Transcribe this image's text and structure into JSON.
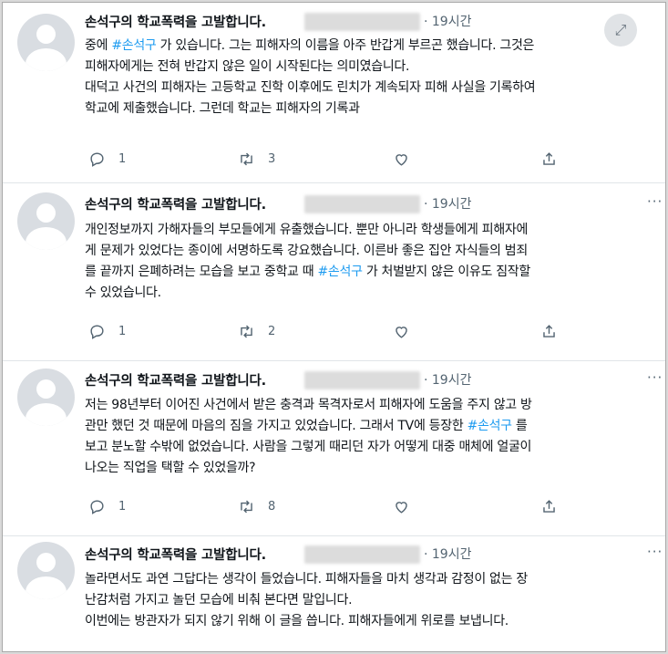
{
  "tweets": [
    {
      "name": "손석구의 학교폭력을 고발합니다.",
      "time": "· 19시간",
      "more": "···",
      "lines": [
        [
          "중에 ",
          "#손석구",
          " 가 있습니다. 그는 피해자의 이름을 아주 반갑게 부르곤 했습니다. 그것은"
        ],
        [
          "피해자에게는 전혀 반갑지 않은 일이 시작된다는 의미였습니다."
        ],
        [
          "대덕고 사건의 피해자는 고등학교 진학 이후에도 린치가 계속되자 피해 사실을 기록하여"
        ],
        [
          "학교에 제출했습니다. 그런데 학교는 피해자의 기록과"
        ]
      ],
      "replies": "1",
      "retweets": "3"
    },
    {
      "name": "손석구의 학교폭력을 고발합니다.",
      "time": "· 19시간",
      "more": "···",
      "lines": [
        [
          "개인정보까지 가해자들의 부모들에게 유출했습니다. 뿐만 아니라 학생들에게 피해자에"
        ],
        [
          "게 문제가 있었다는 종이에 서명하도록 강요했습니다. 이른바 좋은 집안 자식들의 범죄"
        ],
        [
          "를 끝까지 은폐하려는 모습을 보고 중학교 때 ",
          "#손석구",
          " 가 처벌받지 않은 이유도 짐작할"
        ],
        [
          "수 있었습니다."
        ]
      ],
      "replies": "1",
      "retweets": "2"
    },
    {
      "name": "손석구의 학교폭력을 고발합니다.",
      "time": "· 19시간",
      "more": "···",
      "lines": [
        [
          "저는 98년부터 이어진 사건에서 받은 충격과 목격자로서 피해자에 도움을 주지 않고 방"
        ],
        [
          "관만 했던 것 때문에 마음의 짐을 가지고 있었습니다. 그래서 TV에 등장한 ",
          "#손석구",
          " 를"
        ],
        [
          "보고 분노할 수밖에 없었습니다. 사람을 그렇게 때리던 자가 어떻게 대중 매체에 얼굴이"
        ],
        [
          "나오는 직업을 택할 수 있었을까?"
        ]
      ],
      "replies": "1",
      "retweets": "8"
    },
    {
      "name": "손석구의 학교폭력을 고발합니다.",
      "time": "· 19시간",
      "more": "···",
      "lines": [
        [
          "놀라면서도 과연 그답다는 생각이 들었습니다. 피해자들을 마치 생각과 감정이 없는 장"
        ],
        [
          "난감처럼 가지고 놀던 모습에 비춰 본다면 말입니다."
        ],
        [
          "이번에는 방관자가 되지 않기 위해 이 글을 씁니다. 피해자들에게 위로를 보냅니다."
        ]
      ]
    }
  ],
  "colors": {
    "hashtag": "#1d9bf0",
    "muted": "#536471",
    "text": "#0f1419"
  },
  "icons": [
    "reply-icon",
    "retweet-icon",
    "like-icon",
    "share-icon",
    "expand-icon",
    "more-icon"
  ]
}
